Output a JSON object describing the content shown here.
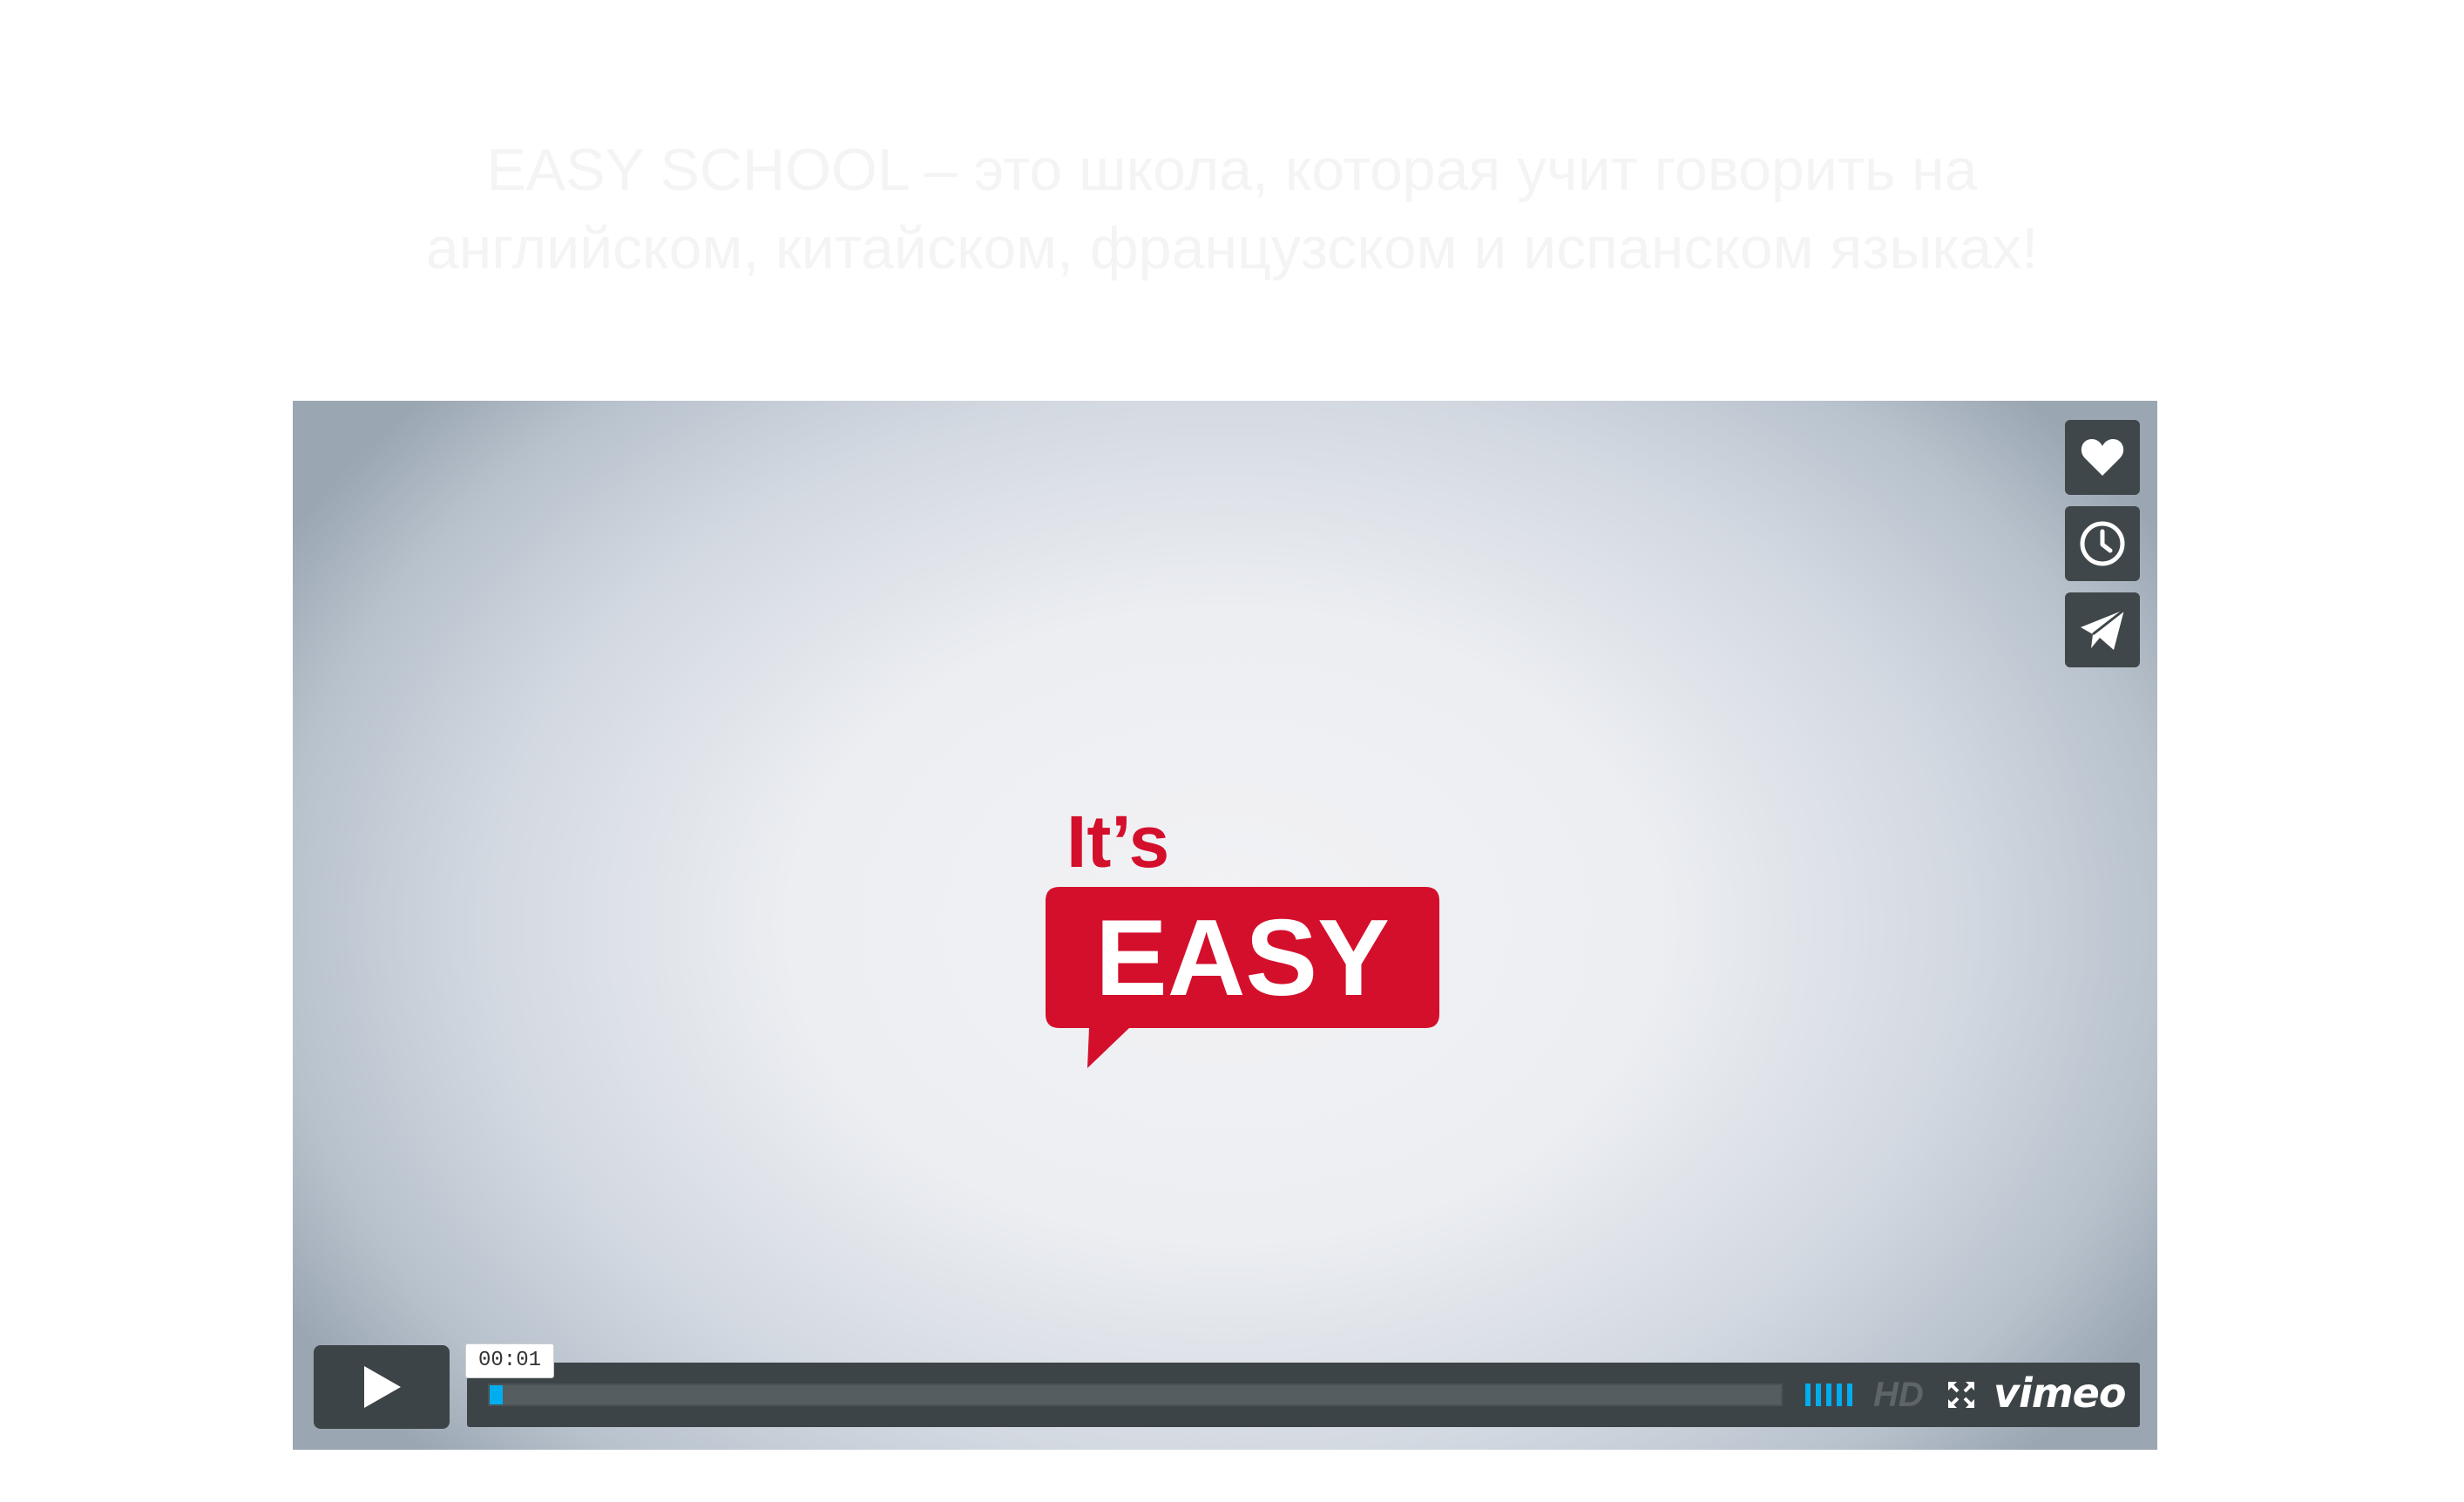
{
  "heading": {
    "line1": "EASY SCHOOL – это школа, которая учит говорить на",
    "line2": "английском, китайском, французском и испанском языках!"
  },
  "player": {
    "logo": {
      "line1": "It’s",
      "line2": "EASY",
      "brand_color": "#d40f2c"
    },
    "side_buttons": [
      {
        "icon": "heart-icon",
        "label": "Like"
      },
      {
        "icon": "clock-icon",
        "label": "Watch Later"
      },
      {
        "icon": "paper-plane-icon",
        "label": "Share"
      }
    ],
    "controls": {
      "play_icon": "play-icon",
      "timecode": "00:01",
      "progress_fraction": 0.01,
      "hd_label": "HD",
      "fullscreen_icon": "fullscreen-icon",
      "brand": "vimeo",
      "volume_icon": "volume-bars-icon"
    },
    "colors": {
      "accent": "#00adef",
      "control_bg": "#3d4447"
    }
  }
}
